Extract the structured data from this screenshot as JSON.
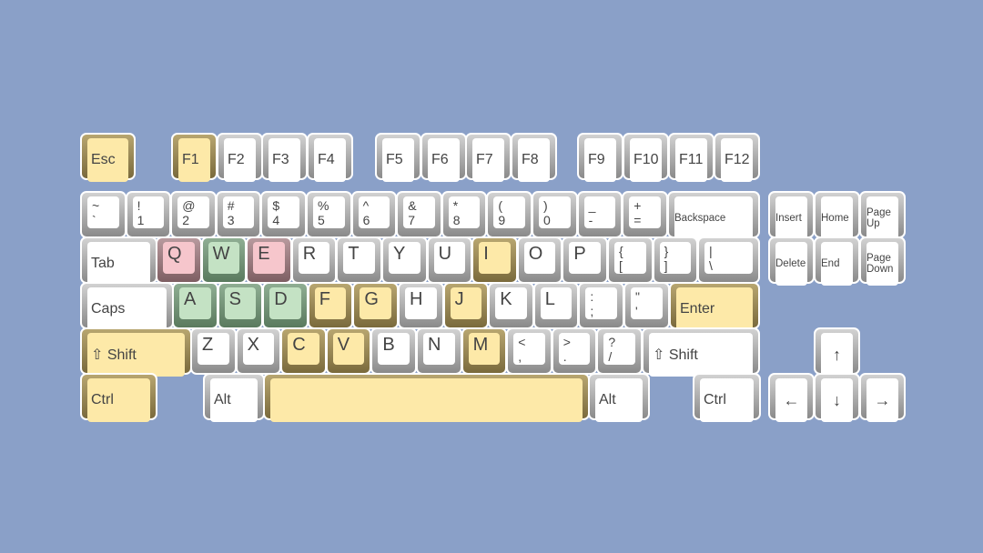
{
  "colors": {
    "background": "#8aa0c8",
    "yellow": "#fde9a8",
    "pink": "#f6c6cc",
    "green": "#c4e2c4",
    "white": "#ffffff"
  },
  "rows": [
    [
      {
        "label": "Esc",
        "color": "yellow"
      },
      {
        "label": "F1",
        "color": "yellow"
      },
      {
        "label": "F2"
      },
      {
        "label": "F3"
      },
      {
        "label": "F4"
      },
      {
        "label": "F5"
      },
      {
        "label": "F6"
      },
      {
        "label": "F7"
      },
      {
        "label": "F8"
      },
      {
        "label": "F9"
      },
      {
        "label": "F10"
      },
      {
        "label": "F11"
      },
      {
        "label": "F12"
      }
    ],
    [
      {
        "top": "~",
        "bottom": "`"
      },
      {
        "top": "!",
        "bottom": "1"
      },
      {
        "top": "@",
        "bottom": "2"
      },
      {
        "top": "#",
        "bottom": "3"
      },
      {
        "top": "$",
        "bottom": "4"
      },
      {
        "top": "%",
        "bottom": "5"
      },
      {
        "top": "^",
        "bottom": "6"
      },
      {
        "top": "&",
        "bottom": "7"
      },
      {
        "top": "*",
        "bottom": "8"
      },
      {
        "top": "(",
        "bottom": "9"
      },
      {
        "top": ")",
        "bottom": "0"
      },
      {
        "top": "_",
        "bottom": "-"
      },
      {
        "top": "+",
        "bottom": "="
      },
      {
        "label": "Backspace",
        "kind": "nav"
      },
      {
        "label": "Insert",
        "kind": "nav"
      },
      {
        "label": "Home",
        "kind": "nav"
      },
      {
        "top": "Page",
        "bottom": "Up",
        "kind": "nav2"
      }
    ],
    [
      {
        "label": "Tab"
      },
      {
        "label": "Q",
        "color": "pink",
        "kind": "letter"
      },
      {
        "label": "W",
        "color": "green",
        "kind": "letter"
      },
      {
        "label": "E",
        "color": "pink",
        "kind": "letter"
      },
      {
        "label": "R",
        "kind": "letter"
      },
      {
        "label": "T",
        "kind": "letter"
      },
      {
        "label": "Y",
        "kind": "letter"
      },
      {
        "label": "U",
        "kind": "letter"
      },
      {
        "label": "I",
        "color": "yellow",
        "kind": "letter"
      },
      {
        "label": "O",
        "kind": "letter"
      },
      {
        "label": "P",
        "kind": "letter"
      },
      {
        "top": "{",
        "bottom": "["
      },
      {
        "top": "}",
        "bottom": "]"
      },
      {
        "top": "|",
        "bottom": "\\"
      },
      {
        "label": "Delete",
        "kind": "nav"
      },
      {
        "label": "End",
        "kind": "nav"
      },
      {
        "top": "Page",
        "bottom": "Down",
        "kind": "nav2"
      }
    ],
    [
      {
        "label": "Caps"
      },
      {
        "label": "A",
        "color": "green",
        "kind": "letter"
      },
      {
        "label": "S",
        "color": "green",
        "kind": "letter"
      },
      {
        "label": "D",
        "color": "green",
        "kind": "letter"
      },
      {
        "label": "F",
        "color": "yellow",
        "kind": "letter"
      },
      {
        "label": "G",
        "color": "yellow",
        "kind": "letter"
      },
      {
        "label": "H",
        "kind": "letter"
      },
      {
        "label": "J",
        "color": "yellow",
        "kind": "letter"
      },
      {
        "label": "K",
        "kind": "letter"
      },
      {
        "label": "L",
        "kind": "letter"
      },
      {
        "top": ":",
        "bottom": ";"
      },
      {
        "top": "\"",
        "bottom": "'"
      },
      {
        "label": "Enter",
        "color": "yellow"
      }
    ],
    [
      {
        "label": "⇧ Shift",
        "color": "yellow"
      },
      {
        "label": "Z",
        "kind": "letter"
      },
      {
        "label": "X",
        "kind": "letter"
      },
      {
        "label": "C",
        "color": "yellow",
        "kind": "letter"
      },
      {
        "label": "V",
        "color": "yellow",
        "kind": "letter"
      },
      {
        "label": "B",
        "kind": "letter"
      },
      {
        "label": "N",
        "kind": "letter"
      },
      {
        "label": "M",
        "color": "yellow",
        "kind": "letter"
      },
      {
        "top": "<",
        "bottom": ","
      },
      {
        "top": ">",
        "bottom": "."
      },
      {
        "top": "?",
        "bottom": "/"
      },
      {
        "label": "⇧ Shift"
      },
      {
        "label": "↑",
        "kind": "arrow"
      }
    ],
    [
      {
        "label": "Ctrl",
        "color": "yellow"
      },
      {
        "label": "Alt"
      },
      {
        "label": "",
        "color": "yellow"
      },
      {
        "label": "Alt"
      },
      {
        "label": "Ctrl"
      },
      {
        "label": "←",
        "kind": "arrow"
      },
      {
        "label": "↓",
        "kind": "arrow"
      },
      {
        "label": "→",
        "kind": "arrow"
      }
    ]
  ]
}
